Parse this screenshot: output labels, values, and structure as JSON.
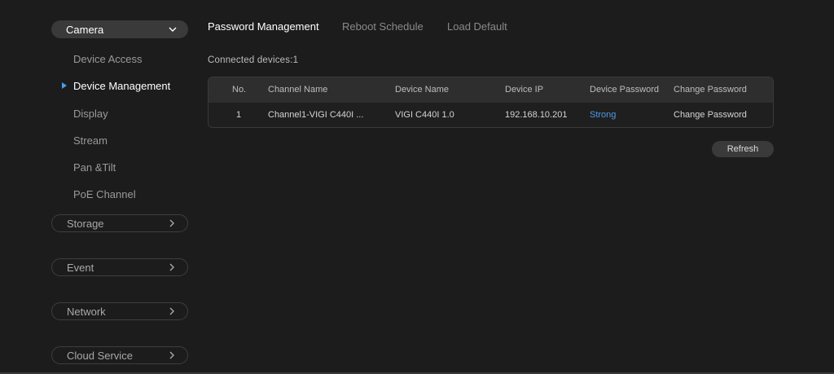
{
  "sidebar": {
    "camera_label": "Camera",
    "camera_items": [
      {
        "label": "Device Access"
      },
      {
        "label": "Device Management"
      },
      {
        "label": "Display"
      },
      {
        "label": "Stream"
      },
      {
        "label": "Pan &Tilt"
      },
      {
        "label": "PoE Channel"
      }
    ],
    "active_item": "Device Management",
    "categories": [
      {
        "label": "Storage"
      },
      {
        "label": "Event"
      },
      {
        "label": "Network"
      },
      {
        "label": "Cloud Service"
      }
    ]
  },
  "tabs": [
    {
      "label": "Password Management",
      "active": true
    },
    {
      "label": "Reboot Schedule",
      "active": false
    },
    {
      "label": "Load Default",
      "active": false
    }
  ],
  "connected_text": "Connected devices:1",
  "table": {
    "headers": [
      "No.",
      "Channel Name",
      "Device Name",
      "Device IP",
      "Device Password",
      "Change Password"
    ],
    "rows": [
      [
        "1",
        "Channel1-VIGI C440I ...",
        "VIGI C440I 1.0",
        "192.168.10.201",
        "Strong",
        "Change Password"
      ]
    ]
  },
  "refresh_label": "Refresh",
  "colors": {
    "background": "#1c1c1c",
    "accent": "#4b9be8",
    "active_text": "#ffffff"
  },
  "icons": {
    "expanded": "chevron-down-icon",
    "collapsed": "chevron-right-icon",
    "active_marker": "caret-right-icon"
  }
}
